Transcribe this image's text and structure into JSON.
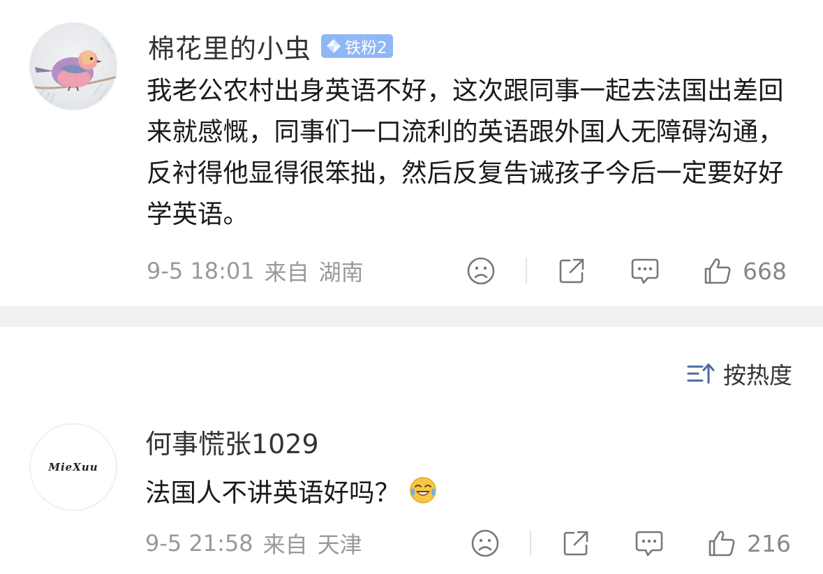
{
  "post": {
    "username": "棉花里的小虫",
    "fan_badge": "铁粉2",
    "content": "我老公农村出身英语不好，这次跟同事一起去法国出差回来就感慨，同事们一口流利的英语跟外国人无障碍沟通，反衬得他显得很笨拙，然后反复告诫孩子今后一定要好好学英语。",
    "time": "9-5 18:01",
    "source_prefix": "来自",
    "location": "湖南",
    "like_count": "668"
  },
  "sort": {
    "label": "按热度"
  },
  "comment": {
    "avatar_text": "MieXuu",
    "username": "何事慌张1029",
    "text": "法国人不讲英语好吗？",
    "time": "9-5 21:58",
    "source_prefix": "来自",
    "location": "天津",
    "like_count": "216"
  },
  "icons": {
    "dislike": "sad-face-icon",
    "share": "share-icon",
    "comment": "comment-bubble-icon",
    "like": "thumbs-up-icon",
    "sort": "sort-icon",
    "badge": "diamond-icon",
    "emoji": "laughing-crying-emoji"
  },
  "colors": {
    "badge_bg": "#8fb7f7",
    "sort_icon": "#4b6aa0",
    "meta_text": "#999999",
    "section_gap": "#f0f1f3"
  }
}
